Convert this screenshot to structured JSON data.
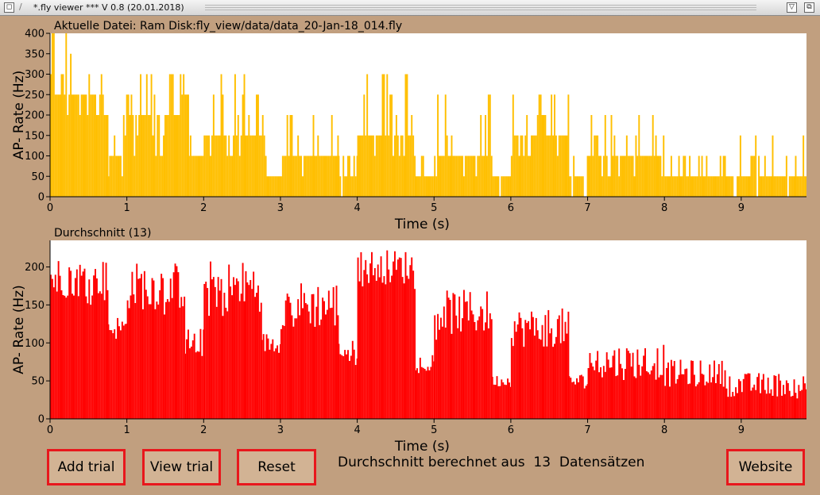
{
  "window": {
    "title": "*.fly viewer *** V 0.8 (20.01.2018)"
  },
  "buttons": {
    "add": "Add trial",
    "view": "View trial",
    "reset": "Reset",
    "website": "Website"
  },
  "status": {
    "prefix": "Durchschnitt berechnet aus",
    "count": "13",
    "suffix": "Datensätzen"
  },
  "colors": {
    "top_series": "#ffbf00",
    "bottom_series": "#ff0000",
    "button_border": "#e8171c",
    "background": "#c19f7f"
  },
  "chart_data": [
    {
      "type": "bar",
      "title": "Aktuelle Datei: Ram Disk:fly_view/data/data_20-Jan-18_014.fly",
      "xlabel": "Time (s)",
      "ylabel": "AP- Rate (Hz)",
      "xlim": [
        0,
        9.85
      ],
      "ylim": [
        0,
        400
      ],
      "x_ticks": [
        0,
        1,
        2,
        3,
        4,
        5,
        6,
        7,
        8,
        9
      ],
      "y_ticks": [
        0,
        50,
        100,
        150,
        200,
        250,
        300,
        350,
        400
      ],
      "bin_width": 0.02,
      "value_step": 50,
      "segments": [
        {
          "x": [
            0.0,
            0.6
          ],
          "typical": 250,
          "low": 200,
          "high": 400
        },
        {
          "x": [
            0.6,
            0.75
          ],
          "typical": 200,
          "low": 150,
          "high": 350
        },
        {
          "x": [
            0.75,
            0.95
          ],
          "typical": 100,
          "low": 50,
          "high": 150
        },
        {
          "x": [
            0.95,
            1.8
          ],
          "typical": 200,
          "low": 100,
          "high": 300
        },
        {
          "x": [
            1.8,
            2.0
          ],
          "typical": 100,
          "low": 50,
          "high": 150
        },
        {
          "x": [
            2.0,
            2.8
          ],
          "typical": 150,
          "low": 100,
          "high": 300
        },
        {
          "x": [
            2.8,
            3.0
          ],
          "typical": 50,
          "low": 50,
          "high": 100
        },
        {
          "x": [
            3.0,
            3.75
          ],
          "typical": 100,
          "low": 50,
          "high": 200
        },
        {
          "x": [
            3.75,
            4.0
          ],
          "typical": 50,
          "low": 0,
          "high": 100
        },
        {
          "x": [
            4.0,
            4.75
          ],
          "typical": 150,
          "low": 100,
          "high": 300
        },
        {
          "x": [
            4.75,
            5.0
          ],
          "typical": 50,
          "low": 50,
          "high": 100
        },
        {
          "x": [
            5.0,
            5.75
          ],
          "typical": 100,
          "low": 50,
          "high": 250
        },
        {
          "x": [
            5.75,
            6.0
          ],
          "typical": 50,
          "low": 0,
          "high": 100
        },
        {
          "x": [
            6.0,
            6.75
          ],
          "typical": 150,
          "low": 100,
          "high": 250
        },
        {
          "x": [
            6.75,
            7.0
          ],
          "typical": 50,
          "low": 0,
          "high": 100
        },
        {
          "x": [
            7.0,
            8.0
          ],
          "typical": 100,
          "low": 50,
          "high": 200
        },
        {
          "x": [
            8.0,
            8.8
          ],
          "typical": 50,
          "low": 50,
          "high": 100
        },
        {
          "x": [
            8.8,
            9.85
          ],
          "typical": 50,
          "low": 0,
          "high": 150
        }
      ]
    },
    {
      "type": "bar",
      "title": "Durchschnitt (13)",
      "xlabel": "Time (s)",
      "ylabel": "AP- Rate (Hz)",
      "xlim": [
        0,
        9.85
      ],
      "ylim": [
        0,
        235
      ],
      "x_ticks": [
        0,
        1,
        2,
        3,
        4,
        5,
        6,
        7,
        8,
        9
      ],
      "y_ticks": [
        0,
        50,
        100,
        150,
        200
      ],
      "bin_width": 0.02,
      "segments": [
        {
          "x": [
            0.0,
            0.75
          ],
          "typical": 185,
          "low": 150,
          "high": 215
        },
        {
          "x": [
            0.75,
            1.0
          ],
          "typical": 120,
          "low": 100,
          "high": 140
        },
        {
          "x": [
            1.0,
            1.75
          ],
          "typical": 175,
          "low": 130,
          "high": 210
        },
        {
          "x": [
            1.75,
            2.0
          ],
          "typical": 100,
          "low": 80,
          "high": 130
        },
        {
          "x": [
            2.0,
            2.75
          ],
          "typical": 175,
          "low": 130,
          "high": 215
        },
        {
          "x": [
            2.75,
            3.0
          ],
          "typical": 100,
          "low": 85,
          "high": 120
        },
        {
          "x": [
            3.0,
            3.75
          ],
          "typical": 150,
          "low": 110,
          "high": 190
        },
        {
          "x": [
            3.75,
            4.0
          ],
          "typical": 90,
          "low": 70,
          "high": 105
        },
        {
          "x": [
            4.0,
            4.75
          ],
          "typical": 200,
          "low": 170,
          "high": 228
        },
        {
          "x": [
            4.75,
            5.0
          ],
          "typical": 75,
          "low": 60,
          "high": 90
        },
        {
          "x": [
            5.0,
            5.75
          ],
          "typical": 140,
          "low": 100,
          "high": 175
        },
        {
          "x": [
            5.75,
            6.0
          ],
          "typical": 50,
          "low": 40,
          "high": 60
        },
        {
          "x": [
            6.0,
            6.75
          ],
          "typical": 120,
          "low": 90,
          "high": 155
        },
        {
          "x": [
            6.75,
            7.0
          ],
          "typical": 50,
          "low": 40,
          "high": 65
        },
        {
          "x": [
            7.0,
            8.0
          ],
          "typical": 75,
          "low": 50,
          "high": 110
        },
        {
          "x": [
            8.0,
            8.8
          ],
          "typical": 60,
          "low": 35,
          "high": 80
        },
        {
          "x": [
            8.8,
            9.85
          ],
          "typical": 45,
          "low": 25,
          "high": 65
        }
      ]
    }
  ]
}
